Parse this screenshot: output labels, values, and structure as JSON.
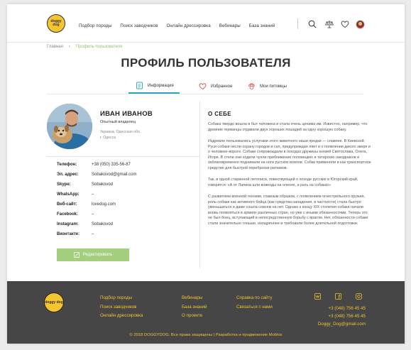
{
  "logo": {
    "text": "doggy dog"
  },
  "nav": [
    "Подбор породы",
    "Поиск заводчиков",
    "Онлайн дрессировка",
    "Вебинары",
    "База знаний"
  ],
  "header_icons": [
    "search-icon",
    "scales-icon",
    "heart-icon",
    "user-avatar"
  ],
  "breadcrumbs": {
    "home": "Главная",
    "sep": "›",
    "current": "Профиль пользователя"
  },
  "page_title": "ПРОФИЛЬ ПОЛЬЗОВАТЕЛЯ",
  "tabs": [
    {
      "label": "Информация",
      "icon": "info-icon",
      "active": true
    },
    {
      "label": "Избранное",
      "icon": "heart-icon",
      "active": false
    },
    {
      "label": "Мои питомцы",
      "icon": "paw-icon",
      "active": false
    }
  ],
  "user": {
    "name": "ИВАН ИВАНОВ",
    "status": "Опытный владелец",
    "location_line1": "Украина, Одесская обл.",
    "location_line2": "г. Одесса"
  },
  "contacts": [
    {
      "label": "Телефон:",
      "value": "+38 (050) 335-56-87"
    },
    {
      "label": "Эл. адрес:",
      "value": "Sobakovod@gmail.com"
    },
    {
      "label": "Skype:",
      "value": "Sobakovod"
    },
    {
      "label": "WhatsApp:",
      "value": "–"
    },
    {
      "label": "Веб-сайт:",
      "value": "lovedog.com"
    },
    {
      "label": "Facebook:",
      "value": "–"
    },
    {
      "label": "Instagram:",
      "value": "Sobakovod"
    },
    {
      "label": "Вконтакте:",
      "value": "–"
    }
  ],
  "edit_button": "Редактировать",
  "about": {
    "heading": "О СЕБЕ",
    "paragraphs": [
      "Собака твердо вошла в быт человека и стала очень ценима им. Известно, например, что древние германцы отдавали двух хороших лошадей за одну хорошую собаку.",
      "Издревле пользовались услугами этого животного наши предки — славяне. В Киевской Руси собаки несли охрану городов и сел, предупреждая ляет и о появлении дикого зверя и о человеке-ворогe. Собаки сопровождали в походах дружины князей Святослава, Олега, Игоря. В степи они ходили чуяли приближение половецких и татарских наездников и заблаговременно поднимали на ноги русских воинов. Собак применяли и как транспортное средство для быстрой переброски ратников.",
      "Так, в одной старинной летописи, повествующей о походе русских в Югорский край, говорится: «А от Лапина шли вовеоды на оленях, а рать на собаках»",
      "С развитием военной техники, главным образом, с появлением огнестрельного оружия, роль собаки как активного бойца (как средства нападения, в частности) стала быстро уменьшаться и даже сошла совсем на нет. Однако к концу XIX столетия собаки начали вновь появляться в армиях различных стран, но уже с иными обязанностями. Теперь это не был боец, вступающий в непосредственную борьбу с врагом. Нет, обязанности собаки стали значительно тоньше, изощреннее и требовали более длительной подготовки."
    ]
  },
  "footer": {
    "logo_text": "doggy dog",
    "col1": [
      "Подбор породы",
      "Поиск заводчиков",
      "Онлайн дрессировка"
    ],
    "col2": [
      "Вебинары",
      "База знаний",
      "О проекте"
    ],
    "col3": [
      "Справка по сайту",
      "Связаться с нами"
    ],
    "social_icons": [
      "vk-icon",
      "facebook-icon",
      "instagram-icon"
    ],
    "phone1": "+3 (048) 756 45 45",
    "phone2": "+3 (048) 756 45 45",
    "email": "Doggy_Dog@gmail.com",
    "copyright": "© 2018 DOGGYDOG. Все права защищены | Разработка и продвижение Moblos"
  }
}
